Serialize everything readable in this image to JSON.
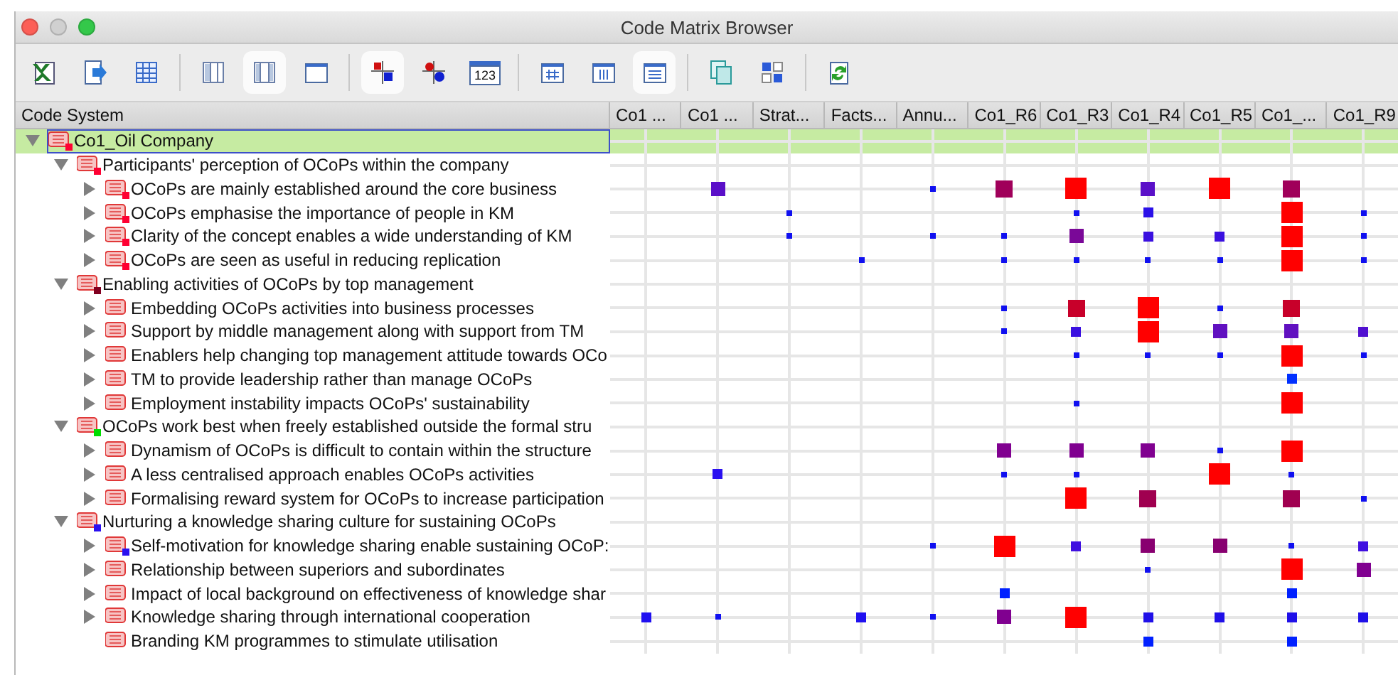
{
  "window": {
    "title": "Code Matrix Browser"
  },
  "toolbar": [
    {
      "buttons": [
        {
          "kind": "spreadsheet",
          "pressed": false
        },
        {
          "kind": "export",
          "pressed": false
        },
        {
          "kind": "table",
          "pressed": false
        }
      ]
    },
    {
      "buttons": [
        {
          "kind": "layout-left",
          "pressed": false
        },
        {
          "kind": "layout-both",
          "pressed": true
        },
        {
          "kind": "layout-none",
          "pressed": false
        }
      ]
    },
    {
      "buttons": [
        {
          "kind": "squares",
          "pressed": true
        },
        {
          "kind": "circles",
          "pressed": false
        },
        {
          "kind": "numbers",
          "label": "123",
          "pressed": false
        }
      ]
    },
    {
      "buttons": [
        {
          "kind": "table-rows",
          "pressed": false
        },
        {
          "kind": "table-cols",
          "pressed": false
        },
        {
          "kind": "table-lines",
          "pressed": true
        }
      ]
    },
    {
      "buttons": [
        {
          "kind": "copy",
          "pressed": false
        },
        {
          "kind": "grid",
          "pressed": false
        }
      ]
    },
    {
      "buttons": [
        {
          "kind": "refresh",
          "pressed": false
        }
      ]
    }
  ],
  "columns": [
    "Code System",
    "Co1 ...",
    "Co1 ...",
    "Strat...",
    "Facts...",
    "Annu...",
    "Co1_R6",
    "Co1_R3",
    "Co1_R4",
    "Co1_R5",
    "Co1_...",
    "Co1_R9"
  ],
  "tree": [
    {
      "label": "Co1_Oil Company",
      "kind": "node",
      "expanded": true,
      "selected": true,
      "color": "#ff0033",
      "cells": [
        {
          "kind": "none"
        },
        {
          "kind": "none"
        },
        {
          "kind": "none"
        },
        {
          "kind": "none"
        },
        {
          "kind": "none"
        },
        {
          "kind": "none"
        },
        {
          "kind": "none"
        },
        {
          "kind": "none"
        },
        {
          "kind": "none"
        },
        {
          "kind": "none"
        },
        {
          "kind": "none"
        }
      ],
      "children": [
        {
          "label": "Participants' perception of OCoPs within the company",
          "kind": "node",
          "expanded": true,
          "selected": false,
          "color": "#ff0033",
          "cells": [
            {
              "kind": "none"
            },
            {
              "kind": "none"
            },
            {
              "kind": "none"
            },
            {
              "kind": "none"
            },
            {
              "kind": "none"
            },
            {
              "kind": "none"
            },
            {
              "kind": "none"
            },
            {
              "kind": "none"
            },
            {
              "kind": "none"
            },
            {
              "kind": "none"
            },
            {
              "kind": "none"
            }
          ],
          "children": [
            {
              "label": "OCoPs are mainly established around the core business",
              "kind": "node",
              "expanded": false,
              "selected": false,
              "color": "#ff0033",
              "cells": [
                {
                  "kind": "none"
                },
                {
                  "kind": "medium",
                  "color": "#5a0fc8"
                },
                {
                  "kind": "none"
                },
                {
                  "kind": "none"
                },
                {
                  "kind": "dot",
                  "color": "#1010f0"
                },
                {
                  "kind": "big",
                  "color": "#a0005a"
                },
                {
                  "kind": "large",
                  "color": "#ff0000"
                },
                {
                  "kind": "medium",
                  "color": "#5a10c8"
                },
                {
                  "kind": "large",
                  "color": "#ff0000"
                },
                {
                  "kind": "big",
                  "color": "#a0005a"
                },
                {
                  "kind": "none"
                }
              ]
            },
            {
              "label": "OCoPs emphasise the importance of people in KM",
              "kind": "node",
              "expanded": false,
              "selected": false,
              "color": "#ff0033",
              "cells": [
                {
                  "kind": "none"
                },
                {
                  "kind": "none"
                },
                {
                  "kind": "dot",
                  "color": "#1010f0"
                },
                {
                  "kind": "none"
                },
                {
                  "kind": "none"
                },
                {
                  "kind": "none"
                },
                {
                  "kind": "dot",
                  "color": "#1010f0"
                },
                {
                  "kind": "small",
                  "color": "#2a10e8"
                },
                {
                  "kind": "none"
                },
                {
                  "kind": "large",
                  "color": "#ff0000"
                },
                {
                  "kind": "dot",
                  "color": "#1010f0"
                }
              ]
            },
            {
              "label": "Clarity of the concept enables a wide understanding of KM",
              "kind": "node",
              "expanded": false,
              "selected": false,
              "color": "#ff0033",
              "cells": [
                {
                  "kind": "none"
                },
                {
                  "kind": "none"
                },
                {
                  "kind": "dot",
                  "color": "#1010f0"
                },
                {
                  "kind": "none"
                },
                {
                  "kind": "dot",
                  "color": "#1010f0"
                },
                {
                  "kind": "dot",
                  "color": "#1010f0"
                },
                {
                  "kind": "medium",
                  "color": "#7a0898"
                },
                {
                  "kind": "small",
                  "color": "#3a10e0"
                },
                {
                  "kind": "small",
                  "color": "#3a10e0"
                },
                {
                  "kind": "large",
                  "color": "#ff0000"
                },
                {
                  "kind": "dot",
                  "color": "#1010f0"
                }
              ]
            },
            {
              "label": "OCoPs are seen as useful in reducing replication",
              "kind": "node",
              "expanded": false,
              "selected": false,
              "color": "#ff0033",
              "cells": [
                {
                  "kind": "none"
                },
                {
                  "kind": "none"
                },
                {
                  "kind": "none"
                },
                {
                  "kind": "dot",
                  "color": "#1010f0"
                },
                {
                  "kind": "none"
                },
                {
                  "kind": "dot",
                  "color": "#1010f0"
                },
                {
                  "kind": "dot",
                  "color": "#1010f0"
                },
                {
                  "kind": "dot",
                  "color": "#1010f0"
                },
                {
                  "kind": "dot",
                  "color": "#1010f0"
                },
                {
                  "kind": "large",
                  "color": "#ff0000"
                },
                {
                  "kind": "dot",
                  "color": "#1010f0"
                }
              ]
            }
          ]
        },
        {
          "label": "Enabling activities of OCoPs by top management",
          "kind": "node",
          "expanded": true,
          "selected": false,
          "color": "#800020",
          "cells": [
            {
              "kind": "none"
            },
            {
              "kind": "none"
            },
            {
              "kind": "none"
            },
            {
              "kind": "none"
            },
            {
              "kind": "none"
            },
            {
              "kind": "none"
            },
            {
              "kind": "none"
            },
            {
              "kind": "none"
            },
            {
              "kind": "none"
            },
            {
              "kind": "none"
            },
            {
              "kind": "none"
            }
          ],
          "children": [
            {
              "label": "Embedding OCoPs activities into business processes",
              "kind": "node",
              "expanded": false,
              "selected": false,
              "cells": [
                {
                  "kind": "none"
                },
                {
                  "kind": "none"
                },
                {
                  "kind": "none"
                },
                {
                  "kind": "none"
                },
                {
                  "kind": "none"
                },
                {
                  "kind": "dot",
                  "color": "#1010f0"
                },
                {
                  "kind": "big",
                  "color": "#c8002a"
                },
                {
                  "kind": "large",
                  "color": "#ff0000"
                },
                {
                  "kind": "dot",
                  "color": "#1010f0"
                },
                {
                  "kind": "big",
                  "color": "#c8002a"
                },
                {
                  "kind": "none"
                }
              ]
            },
            {
              "label": "Support by middle management along with support from TM",
              "kind": "node",
              "expanded": false,
              "selected": false,
              "cells": [
                {
                  "kind": "none"
                },
                {
                  "kind": "none"
                },
                {
                  "kind": "none"
                },
                {
                  "kind": "none"
                },
                {
                  "kind": "none"
                },
                {
                  "kind": "dot",
                  "color": "#1010f0"
                },
                {
                  "kind": "small",
                  "color": "#3a10e0"
                },
                {
                  "kind": "large",
                  "color": "#ff0000"
                },
                {
                  "kind": "medium",
                  "color": "#6010c0"
                },
                {
                  "kind": "medium",
                  "color": "#6010c0"
                },
                {
                  "kind": "small",
                  "color": "#5010d0"
                }
              ]
            },
            {
              "label": "Enablers help changing top management attitude towards OCo",
              "kind": "node",
              "expanded": false,
              "selected": false,
              "cells": [
                {
                  "kind": "none"
                },
                {
                  "kind": "none"
                },
                {
                  "kind": "none"
                },
                {
                  "kind": "none"
                },
                {
                  "kind": "none"
                },
                {
                  "kind": "none"
                },
                {
                  "kind": "dot",
                  "color": "#1010f0"
                },
                {
                  "kind": "dot",
                  "color": "#1010f0"
                },
                {
                  "kind": "dot",
                  "color": "#1010f0"
                },
                {
                  "kind": "large",
                  "color": "#ff0000"
                },
                {
                  "kind": "dot",
                  "color": "#1010f0"
                }
              ]
            },
            {
              "label": "TM to provide leadership rather than manage OCoPs",
              "kind": "node",
              "expanded": false,
              "selected": false,
              "cells": [
                {
                  "kind": "none"
                },
                {
                  "kind": "none"
                },
                {
                  "kind": "none"
                },
                {
                  "kind": "none"
                },
                {
                  "kind": "none"
                },
                {
                  "kind": "none"
                },
                {
                  "kind": "none"
                },
                {
                  "kind": "none"
                },
                {
                  "kind": "none"
                },
                {
                  "kind": "small",
                  "color": "#0030ff"
                },
                {
                  "kind": "none"
                }
              ]
            },
            {
              "label": "Employment instability impacts OCoPs' sustainability",
              "kind": "node",
              "expanded": false,
              "selected": false,
              "cells": [
                {
                  "kind": "none"
                },
                {
                  "kind": "none"
                },
                {
                  "kind": "none"
                },
                {
                  "kind": "none"
                },
                {
                  "kind": "none"
                },
                {
                  "kind": "none"
                },
                {
                  "kind": "dot",
                  "color": "#1010f0"
                },
                {
                  "kind": "none"
                },
                {
                  "kind": "none"
                },
                {
                  "kind": "large",
                  "color": "#ff0000"
                },
                {
                  "kind": "none"
                }
              ]
            }
          ]
        },
        {
          "label": "OCoPs work best when freely established outside the formal stru",
          "kind": "node",
          "expanded": true,
          "selected": false,
          "color": "#00dd00",
          "cells": [
            {
              "kind": "none"
            },
            {
              "kind": "none"
            },
            {
              "kind": "none"
            },
            {
              "kind": "none"
            },
            {
              "kind": "none"
            },
            {
              "kind": "none"
            },
            {
              "kind": "none"
            },
            {
              "kind": "none"
            },
            {
              "kind": "none"
            },
            {
              "kind": "none"
            },
            {
              "kind": "none"
            }
          ],
          "children": [
            {
              "label": "Dynamism of OCoPs is difficult to contain  within the structure",
              "kind": "node",
              "expanded": false,
              "selected": false,
              "cells": [
                {
                  "kind": "none"
                },
                {
                  "kind": "none"
                },
                {
                  "kind": "none"
                },
                {
                  "kind": "none"
                },
                {
                  "kind": "none"
                },
                {
                  "kind": "medium",
                  "color": "#800090"
                },
                {
                  "kind": "medium",
                  "color": "#800090"
                },
                {
                  "kind": "medium",
                  "color": "#800090"
                },
                {
                  "kind": "dot",
                  "color": "#1010f0"
                },
                {
                  "kind": "large",
                  "color": "#ff0000"
                },
                {
                  "kind": "none"
                }
              ]
            },
            {
              "label": "A less centralised approach enables OCoPs activities",
              "kind": "node",
              "expanded": false,
              "selected": false,
              "cells": [
                {
                  "kind": "none"
                },
                {
                  "kind": "small",
                  "color": "#2a10f0"
                },
                {
                  "kind": "none"
                },
                {
                  "kind": "none"
                },
                {
                  "kind": "none"
                },
                {
                  "kind": "dot",
                  "color": "#1010f0"
                },
                {
                  "kind": "dot",
                  "color": "#1010f0"
                },
                {
                  "kind": "none"
                },
                {
                  "kind": "large",
                  "color": "#ff0000"
                },
                {
                  "kind": "dot",
                  "color": "#1010f0"
                },
                {
                  "kind": "none"
                }
              ]
            },
            {
              "label": "Formalising reward system for OCoPs to increase participation",
              "kind": "node",
              "expanded": false,
              "selected": false,
              "cells": [
                {
                  "kind": "none"
                },
                {
                  "kind": "none"
                },
                {
                  "kind": "none"
                },
                {
                  "kind": "none"
                },
                {
                  "kind": "none"
                },
                {
                  "kind": "none"
                },
                {
                  "kind": "large",
                  "color": "#ff0000"
                },
                {
                  "kind": "big",
                  "color": "#a00050"
                },
                {
                  "kind": "none"
                },
                {
                  "kind": "big",
                  "color": "#a00050"
                },
                {
                  "kind": "dot",
                  "color": "#1010f0"
                }
              ]
            }
          ]
        },
        {
          "label": "Nurturing a knowledge sharing culture for sustaining OCoPs",
          "kind": "node",
          "expanded": true,
          "selected": false,
          "color": "#2a10f0",
          "cells": [
            {
              "kind": "none"
            },
            {
              "kind": "none"
            },
            {
              "kind": "none"
            },
            {
              "kind": "none"
            },
            {
              "kind": "none"
            },
            {
              "kind": "none"
            },
            {
              "kind": "none"
            },
            {
              "kind": "none"
            },
            {
              "kind": "none"
            },
            {
              "kind": "none"
            },
            {
              "kind": "none"
            }
          ],
          "children": [
            {
              "label": "Self-motivation for knowledge sharing enable sustaining OCoP:",
              "kind": "node",
              "expanded": false,
              "selected": false,
              "color": "#2a10f0",
              "cells": [
                {
                  "kind": "none"
                },
                {
                  "kind": "none"
                },
                {
                  "kind": "none"
                },
                {
                  "kind": "none"
                },
                {
                  "kind": "dot",
                  "color": "#1010f0"
                },
                {
                  "kind": "large",
                  "color": "#ff0000"
                },
                {
                  "kind": "small",
                  "color": "#4010e0"
                },
                {
                  "kind": "medium",
                  "color": "#880070"
                },
                {
                  "kind": "medium",
                  "color": "#880070"
                },
                {
                  "kind": "dot",
                  "color": "#1010f0"
                },
                {
                  "kind": "small",
                  "color": "#4010e0"
                }
              ]
            },
            {
              "label": "Relationship between superiors and subordinates",
              "kind": "node",
              "expanded": false,
              "selected": false,
              "cells": [
                {
                  "kind": "none"
                },
                {
                  "kind": "none"
                },
                {
                  "kind": "none"
                },
                {
                  "kind": "none"
                },
                {
                  "kind": "none"
                },
                {
                  "kind": "none"
                },
                {
                  "kind": "none"
                },
                {
                  "kind": "dot",
                  "color": "#1010f0"
                },
                {
                  "kind": "none"
                },
                {
                  "kind": "large",
                  "color": "#ff0000"
                },
                {
                  "kind": "medium",
                  "color": "#800090"
                }
              ]
            },
            {
              "label": "Impact of local background on effectiveness of knowledge shar",
              "kind": "node",
              "expanded": false,
              "selected": false,
              "cells": [
                {
                  "kind": "none"
                },
                {
                  "kind": "none"
                },
                {
                  "kind": "none"
                },
                {
                  "kind": "none"
                },
                {
                  "kind": "none"
                },
                {
                  "kind": "small",
                  "color": "#0020ff"
                },
                {
                  "kind": "none"
                },
                {
                  "kind": "none"
                },
                {
                  "kind": "none"
                },
                {
                  "kind": "small",
                  "color": "#0020ff"
                },
                {
                  "kind": "none"
                }
              ]
            },
            {
              "label": "Knowledge sharing through international cooperation",
              "kind": "node",
              "expanded": false,
              "selected": false,
              "cells": [
                {
                  "kind": "small",
                  "color": "#2010f0"
                },
                {
                  "kind": "dot",
                  "color": "#1010f0"
                },
                {
                  "kind": "none"
                },
                {
                  "kind": "small",
                  "color": "#2010f0"
                },
                {
                  "kind": "dot",
                  "color": "#1010f0"
                },
                {
                  "kind": "medium",
                  "color": "#800090"
                },
                {
                  "kind": "large",
                  "color": "#ff0000"
                },
                {
                  "kind": "small",
                  "color": "#2010e8"
                },
                {
                  "kind": "small",
                  "color": "#2010e8"
                },
                {
                  "kind": "small",
                  "color": "#2010e8"
                },
                {
                  "kind": "small",
                  "color": "#2010e8"
                }
              ]
            },
            {
              "label": "Branding KM programmes to stimulate utilisation",
              "kind": "leaf",
              "selected": false,
              "cells": [
                {
                  "kind": "none"
                },
                {
                  "kind": "none"
                },
                {
                  "kind": "none"
                },
                {
                  "kind": "none"
                },
                {
                  "kind": "none"
                },
                {
                  "kind": "none"
                },
                {
                  "kind": "none"
                },
                {
                  "kind": "small",
                  "color": "#0020ff"
                },
                {
                  "kind": "none"
                },
                {
                  "kind": "small",
                  "color": "#0020ff"
                },
                {
                  "kind": "none"
                }
              ]
            }
          ]
        }
      ]
    }
  ]
}
